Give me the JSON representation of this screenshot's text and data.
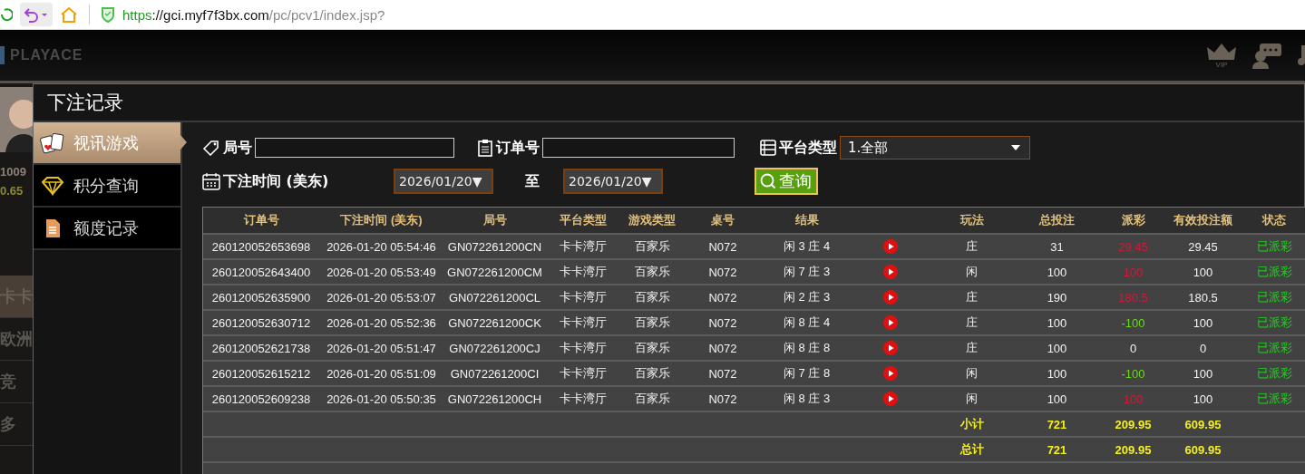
{
  "browser": {
    "url": {
      "scheme": "https",
      "host": "://gci.myf7f3bx.com",
      "path": "/pc/pcv1/index.jsp?"
    }
  },
  "app_header": {
    "logo": "PLAYACE",
    "vip_label": "VIP"
  },
  "background_panel": {
    "balance": "1009",
    "points": "0.65",
    "items": [
      {
        "label": "卡卡",
        "selected": true
      },
      {
        "label": "欧洲",
        "selected": false
      },
      {
        "label": "竞",
        "selected": false
      },
      {
        "label": "多",
        "selected": false
      }
    ]
  },
  "dialog": {
    "title": "下注记录",
    "sidebar": {
      "items": [
        {
          "label": "视讯游戏",
          "kind": "cards",
          "selected": true
        },
        {
          "label": "积分查询",
          "kind": "diamond",
          "selected": false
        },
        {
          "label": "额度记录",
          "kind": "document",
          "selected": false
        }
      ]
    },
    "filters": {
      "round_label": "局号",
      "order_label": "订单号",
      "platform_label": "平台类型",
      "platform_value": "1.全部",
      "time_label": "下注时间 (美东)",
      "date_from": "2026/01/20▼",
      "to_label": "至",
      "date_to": "2026/01/20▼",
      "query_button": "查询"
    },
    "table": {
      "columns": [
        "订单号",
        "下注时间 (美东)",
        "局号",
        "平台类型",
        "游戏类型",
        "桌号",
        "结果",
        "",
        "玩法",
        "总投注",
        "派彩",
        "有效投注额",
        "状态"
      ],
      "rows": [
        {
          "order": "260120052653698",
          "time": "2026-01-20 05:54:46",
          "round": "GN072261200CN",
          "platform": "卡卡湾厅",
          "game": "百家乐",
          "table": "N072",
          "result": "闲 3 庄 4",
          "bet_on": "庄",
          "total_bet": "31",
          "payout": "29.45",
          "color": "#d01a3a",
          "valid_bet": "29.45",
          "status": "已派彩"
        },
        {
          "order": "260120052643400",
          "time": "2026-01-20 05:53:49",
          "round": "GN072261200CM",
          "platform": "卡卡湾厅",
          "game": "百家乐",
          "table": "N072",
          "result": "闲 7 庄 3",
          "bet_on": "闲",
          "total_bet": "100",
          "payout": "100",
          "color": "#d01a3a",
          "valid_bet": "100",
          "status": "已派彩"
        },
        {
          "order": "260120052635900",
          "time": "2026-01-20 05:53:07",
          "round": "GN072261200CL",
          "platform": "卡卡湾厅",
          "game": "百家乐",
          "table": "N072",
          "result": "闲 2 庄 3",
          "bet_on": "庄",
          "total_bet": "190",
          "payout": "180.5",
          "color": "#d01a3a",
          "valid_bet": "180.5",
          "status": "已派彩"
        },
        {
          "order": "260120052630712",
          "time": "2026-01-20 05:52:36",
          "round": "GN072261200CK",
          "platform": "卡卡湾厅",
          "game": "百家乐",
          "table": "N072",
          "result": "闲 8 庄 4",
          "bet_on": "庄",
          "total_bet": "100",
          "payout": "-100",
          "color": "#6ad81a",
          "valid_bet": "100",
          "status": "已派彩"
        },
        {
          "order": "260120052621738",
          "time": "2026-01-20 05:51:47",
          "round": "GN072261200CJ",
          "platform": "卡卡湾厅",
          "game": "百家乐",
          "table": "N072",
          "result": "闲 8 庄 8",
          "bet_on": "庄",
          "total_bet": "100",
          "payout": "0",
          "color": "#f2f2f2",
          "valid_bet": "0",
          "status": "已派彩"
        },
        {
          "order": "260120052615212",
          "time": "2026-01-20 05:51:09",
          "round": "GN072261200CI",
          "platform": "卡卡湾厅",
          "game": "百家乐",
          "table": "N072",
          "result": "闲 7 庄 8",
          "bet_on": "闲",
          "total_bet": "100",
          "payout": "-100",
          "color": "#6ad81a",
          "valid_bet": "100",
          "status": "已派彩"
        },
        {
          "order": "260120052609238",
          "time": "2026-01-20 05:50:35",
          "round": "GN072261200CH",
          "platform": "卡卡湾厅",
          "game": "百家乐",
          "table": "N072",
          "result": "闲 8 庄 3",
          "bet_on": "闲",
          "total_bet": "100",
          "payout": "100",
          "color": "#d01a3a",
          "valid_bet": "100",
          "status": "已派彩"
        }
      ],
      "summary": [
        {
          "label": "小计",
          "total_bet": "721",
          "payout": "209.95",
          "valid_bet": "609.95"
        },
        {
          "label": "总计",
          "total_bet": "721",
          "payout": "209.95",
          "valid_bet": "609.95"
        }
      ]
    }
  }
}
